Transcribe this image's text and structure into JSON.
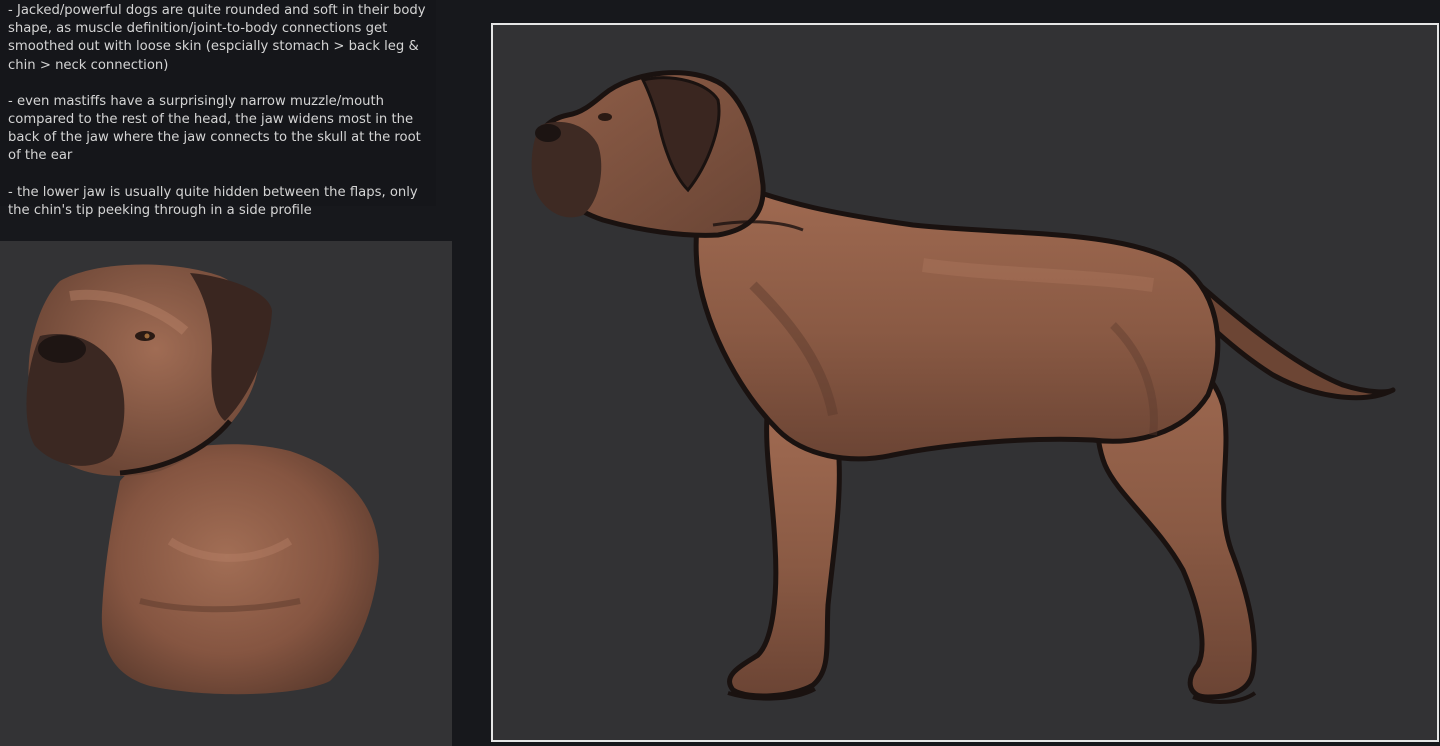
{
  "notes": [
    "- Jacked/powerful dogs are quite rounded and soft in their body shape, as muscle definition/joint-to-body connections get smoothed out with loose skin (espcially stomach > back leg & chin > neck connection)",
    "- even mastiffs have a surprisingly narrow muzzle/mouth compared to the rest of the head, the jaw widens most in the back of the jaw where the jaw connects to the skull at the root of the ear",
    "- the lower jaw is usually quite hidden between the flaps, only the chin's tip peeking through in a side profile"
  ],
  "colors": {
    "background": "#17181c",
    "panel": "#333335",
    "frame": "#e6e6e6",
    "fur": "#8a5a44",
    "fur_shadow": "#4a3028",
    "outline": "#1a1210"
  }
}
